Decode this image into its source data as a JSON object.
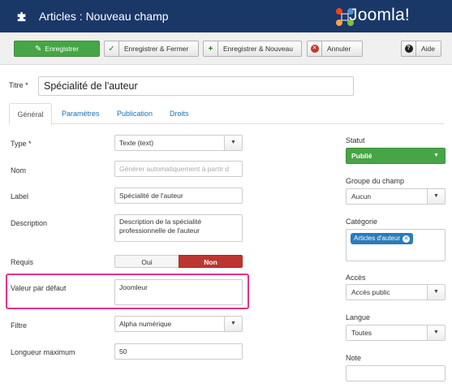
{
  "header": {
    "title": "Articles : Nouveau champ",
    "brand": "Joomla!"
  },
  "toolbar": {
    "save": "Enregistrer",
    "save_close": "Enregistrer & Fermer",
    "save_new": "Enregistrer & Nouveau",
    "cancel": "Annuler",
    "help": "Aide"
  },
  "title_field": {
    "label": "Titre *",
    "value": "Spécialité de l'auteur"
  },
  "tabs": [
    "Général",
    "Paramètres",
    "Publication",
    "Droits"
  ],
  "form": {
    "type": {
      "label": "Type *",
      "value": "Texte (text)"
    },
    "name": {
      "label": "Nom",
      "placeholder": "Générer automatiquement à partir d"
    },
    "field_label": {
      "label": "Label",
      "value": "Spécialité de l'auteur"
    },
    "description": {
      "label": "Description",
      "value": "Description de la spécialité professionnelle de l'auteur"
    },
    "required": {
      "label": "Requis",
      "yes": "Oui",
      "no": "Non",
      "selected": "Non"
    },
    "default_value": {
      "label": "Valeur par défaut",
      "value": "Joomleur"
    },
    "filter": {
      "label": "Filtre",
      "value": "Alpha numérique"
    },
    "max_length": {
      "label": "Longueur maximum",
      "value": "50"
    }
  },
  "sidebar": {
    "status": {
      "label": "Statut",
      "value": "Publié"
    },
    "group": {
      "label": "Groupe du champ",
      "value": "Aucun"
    },
    "category": {
      "label": "Catégorie",
      "chip": "Articles d'auteur"
    },
    "access": {
      "label": "Accès",
      "value": "Accès public"
    },
    "language": {
      "label": "Langue",
      "value": "Toutes"
    },
    "note": {
      "label": "Note",
      "value": ""
    }
  },
  "colors": {
    "header_bg": "#1a3867",
    "save_green": "#46a546",
    "no_red": "#bd362f",
    "highlight_pink": "#e3338b",
    "chip_blue": "#2b7bb9"
  },
  "icons": {
    "header": "puzzle-icon",
    "save": "edit-icon",
    "save_close": "check-icon",
    "save_new": "plus-icon",
    "cancel": "cancel-icon",
    "help": "question-icon"
  }
}
